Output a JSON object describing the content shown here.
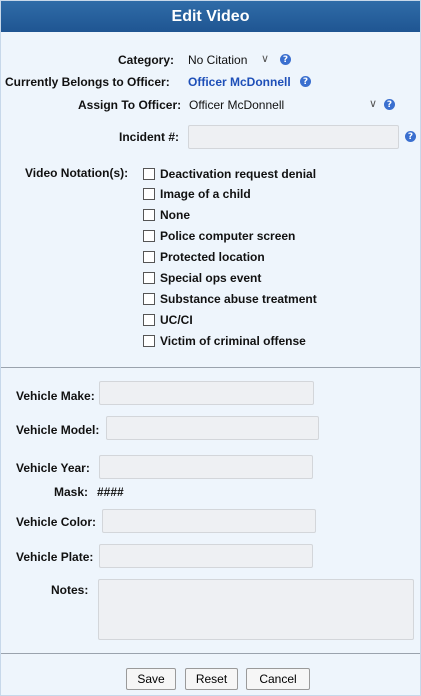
{
  "dialog": {
    "title": "Edit Video"
  },
  "category": {
    "label": "Category:",
    "value": "No Citation"
  },
  "belongs": {
    "label": "Currently Belongs to Officer:",
    "value": "Officer McDonnell"
  },
  "assign": {
    "label": "Assign To Officer:",
    "value": "Officer McDonnell"
  },
  "incident": {
    "label": "Incident #:",
    "value": ""
  },
  "notations": {
    "label": "Video Notation(s):",
    "items": [
      "Deactivation request denial",
      "Image of a child",
      "None",
      "Police computer screen",
      "Protected location",
      "Special ops event",
      "Substance abuse treatment",
      "UC/CI",
      "Victim of criminal offense"
    ]
  },
  "vehicle": {
    "make_label": "Vehicle Make:",
    "model_label": "Vehicle Model:",
    "year_label": "Vehicle Year:",
    "mask_label": "Mask:",
    "mask_value": "####",
    "color_label": "Vehicle Color:",
    "plate_label": "Vehicle Plate:",
    "notes_label": "Notes:"
  },
  "buttons": {
    "save": "Save",
    "reset": "Reset",
    "cancel": "Cancel"
  },
  "icons": {
    "help": "help-icon",
    "chevron": "chevron-down-icon"
  },
  "colors": {
    "title_bar": "#1f5592",
    "panel_bg": "#eef5fc",
    "link": "#1e4fb8"
  }
}
